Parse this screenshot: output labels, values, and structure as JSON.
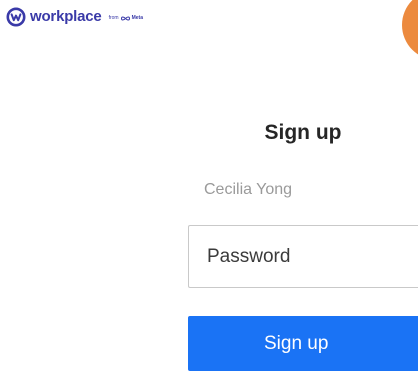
{
  "brand": {
    "logo_icon": "workplace-logo-icon",
    "wordmark": "workplace",
    "from_label": "from",
    "meta_icon": "meta-infinity-icon",
    "meta_label": "Meta",
    "color": "#3a3aa8"
  },
  "avatar": {
    "color": "#ec8a3e"
  },
  "form": {
    "title": "Sign up",
    "name": "Cecilia Yong",
    "password": {
      "value": "",
      "placeholder": "Password"
    },
    "submit_label": "Sign up",
    "submit_color": "#1a73f5"
  }
}
